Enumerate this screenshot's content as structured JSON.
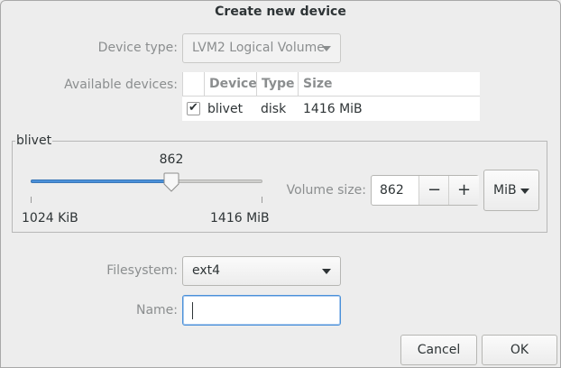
{
  "dialog": {
    "title": "Create new device"
  },
  "device_type": {
    "label": "Device type:",
    "value": "LVM2 Logical Volume"
  },
  "available_devices": {
    "label": "Available devices:",
    "columns": [
      "Device",
      "Type",
      "Size"
    ],
    "rows": [
      {
        "checked": true,
        "device": "blivet",
        "type": "disk",
        "size": "1416 MiB"
      }
    ]
  },
  "size_frame": {
    "label": "blivet",
    "slider": {
      "value": "862",
      "min_label": "1024 KiB",
      "max_label": "1416 MiB",
      "fraction": 0.608
    },
    "volume_size": {
      "label": "Volume size:",
      "value": "862",
      "minus": "−",
      "plus": "+"
    },
    "unit": "MiB"
  },
  "filesystem": {
    "label": "Filesystem:",
    "value": "ext4"
  },
  "name": {
    "label": "Name:",
    "value": ""
  },
  "buttons": {
    "cancel": "Cancel",
    "ok": "OK"
  }
}
